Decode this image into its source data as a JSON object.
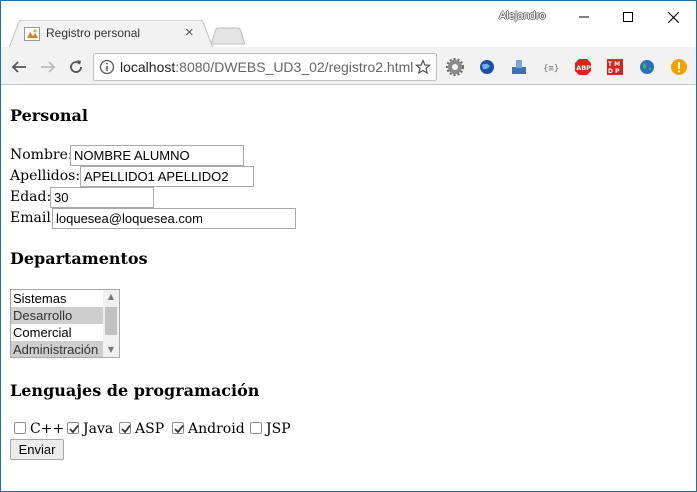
{
  "browser": {
    "tab_title": "Registro personal",
    "tab_close": "×",
    "user_name": "Alejandro",
    "url_host": "localhost",
    "url_path": ":8080/DWEBS_UD3_02/registro2.html"
  },
  "form": {
    "personal_heading": "Personal",
    "nombre_label": "Nombre:",
    "nombre_value": "NOMBRE ALUMNO",
    "apellidos_label": "Apellidos:",
    "apellidos_value": "APELLIDO1 APELLIDO2",
    "edad_label": "Edad:",
    "edad_value": "30",
    "email_label": "Email:",
    "email_value": "loquesea@loquesea.com",
    "departamentos_heading": "Departamentos",
    "departamentos": [
      {
        "label": "Sistemas",
        "selected": false
      },
      {
        "label": "Desarrollo",
        "selected": true
      },
      {
        "label": "Comercial",
        "selected": false
      },
      {
        "label": "Administración",
        "selected": true
      }
    ],
    "lenguajes_heading": "Lenguajes de programación",
    "lenguajes": [
      {
        "label": "C++",
        "checked": false
      },
      {
        "label": "Java",
        "checked": true
      },
      {
        "label": "ASP",
        "checked": true
      },
      {
        "label": "Android",
        "checked": true
      },
      {
        "label": "JSP",
        "checked": false
      }
    ],
    "submit_label": "Enviar"
  },
  "icons": [
    "back-icon",
    "forward-icon",
    "reload-icon",
    "info-icon",
    "bookmark-star-icon",
    "settings-gear-icon",
    "globe-icon",
    "upload-icon",
    "json-icon",
    "adblock-icon",
    "tamper-icon",
    "earth-icon",
    "alert-icon"
  ]
}
